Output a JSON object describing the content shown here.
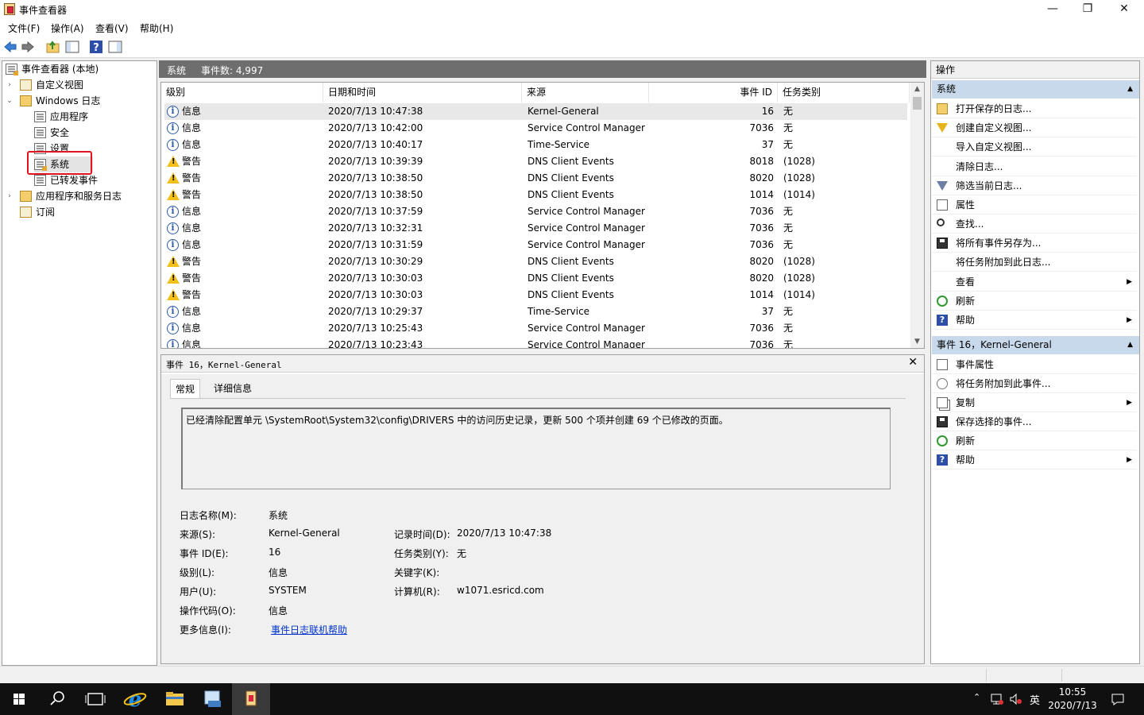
{
  "window": {
    "title": "事件查看器",
    "minimize": "—",
    "restore": "❐",
    "close": "✕"
  },
  "menu": [
    "文件(F)",
    "操作(A)",
    "查看(V)",
    "帮助(H)"
  ],
  "tree": {
    "root": "事件查看器 (本地)",
    "custom_views": "自定义视图",
    "windows_logs": "Windows 日志",
    "application": "应用程序",
    "security": "安全",
    "setup": "设置",
    "system": "系统",
    "forwarded": "已转发事件",
    "apps_services": "应用程序和服务日志",
    "subscriptions": "订阅"
  },
  "center_header": {
    "name": "系统",
    "count": "事件数: 4,997"
  },
  "table": {
    "columns": [
      "级别",
      "日期和时间",
      "来源",
      "事件 ID",
      "任务类别"
    ],
    "rows": [
      {
        "level": "info",
        "level_text": "信息",
        "datetime": "2020/7/13 10:47:38",
        "source": "Kernel-General",
        "id": "16",
        "category": "无"
      },
      {
        "level": "info",
        "level_text": "信息",
        "datetime": "2020/7/13 10:42:00",
        "source": "Service Control Manager",
        "id": "7036",
        "category": "无"
      },
      {
        "level": "info",
        "level_text": "信息",
        "datetime": "2020/7/13 10:40:17",
        "source": "Time-Service",
        "id": "37",
        "category": "无"
      },
      {
        "level": "warn",
        "level_text": "警告",
        "datetime": "2020/7/13 10:39:39",
        "source": "DNS Client Events",
        "id": "8018",
        "category": "(1028)"
      },
      {
        "level": "warn",
        "level_text": "警告",
        "datetime": "2020/7/13 10:38:50",
        "source": "DNS Client Events",
        "id": "8020",
        "category": "(1028)"
      },
      {
        "level": "warn",
        "level_text": "警告",
        "datetime": "2020/7/13 10:38:50",
        "source": "DNS Client Events",
        "id": "1014",
        "category": "(1014)"
      },
      {
        "level": "info",
        "level_text": "信息",
        "datetime": "2020/7/13 10:37:59",
        "source": "Service Control Manager",
        "id": "7036",
        "category": "无"
      },
      {
        "level": "info",
        "level_text": "信息",
        "datetime": "2020/7/13 10:32:31",
        "source": "Service Control Manager",
        "id": "7036",
        "category": "无"
      },
      {
        "level": "info",
        "level_text": "信息",
        "datetime": "2020/7/13 10:31:59",
        "source": "Service Control Manager",
        "id": "7036",
        "category": "无"
      },
      {
        "level": "warn",
        "level_text": "警告",
        "datetime": "2020/7/13 10:30:29",
        "source": "DNS Client Events",
        "id": "8020",
        "category": "(1028)"
      },
      {
        "level": "warn",
        "level_text": "警告",
        "datetime": "2020/7/13 10:30:03",
        "source": "DNS Client Events",
        "id": "8020",
        "category": "(1028)"
      },
      {
        "level": "warn",
        "level_text": "警告",
        "datetime": "2020/7/13 10:30:03",
        "source": "DNS Client Events",
        "id": "1014",
        "category": "(1014)"
      },
      {
        "level": "info",
        "level_text": "信息",
        "datetime": "2020/7/13 10:29:37",
        "source": "Time-Service",
        "id": "37",
        "category": "无"
      },
      {
        "level": "info",
        "level_text": "信息",
        "datetime": "2020/7/13 10:25:43",
        "source": "Service Control Manager",
        "id": "7036",
        "category": "无"
      },
      {
        "level": "info",
        "level_text": "信息",
        "datetime": "2020/7/13 10:23:43",
        "source": "Service Control Manager",
        "id": "7036",
        "category": "无"
      }
    ]
  },
  "detail": {
    "header": "事件 16，Kernel-General",
    "close": "✕",
    "tabs": [
      "常规",
      "详细信息"
    ],
    "message": "已经清除配置单元 \\SystemRoot\\System32\\config\\DRIVERS 中的访问历史记录，更新 500 个项并创建 69 个已修改的页面。",
    "fields": {
      "log_name_label": "日志名称(M):",
      "log_name": "系统",
      "source_label": "来源(S):",
      "source": "Kernel-General",
      "logged_label": "记录时间(D):",
      "logged": "2020/7/13 10:47:38",
      "event_id_label": "事件 ID(E):",
      "event_id": "16",
      "task_label": "任务类别(Y):",
      "task": "无",
      "level_label": "级别(L):",
      "level": "信息",
      "keywords_label": "关键字(K):",
      "user_label": "用户(U):",
      "user": "SYSTEM",
      "computer_label": "计算机(R):",
      "computer": "w1071.esricd.com",
      "opcode_label": "操作代码(O):",
      "opcode": "信息",
      "more_info_label": "更多信息(I):",
      "more_info_link": "事件日志联机帮助"
    }
  },
  "actions": {
    "header": "操作",
    "section1": "系统",
    "items1": [
      "打开保存的日志...",
      "创建自定义视图...",
      "导入自定义视图...",
      "清除日志...",
      "筛选当前日志...",
      "属性",
      "查找...",
      "将所有事件另存为...",
      "将任务附加到此日志...",
      "查看",
      "刷新",
      "帮助"
    ],
    "section2": "事件 16，Kernel-General",
    "items2": [
      "事件属性",
      "将任务附加到此事件...",
      "复制",
      "保存选择的事件...",
      "刷新",
      "帮助"
    ]
  },
  "taskbar": {
    "time": "10:55",
    "date": "2020/7/13",
    "ime": "英"
  }
}
